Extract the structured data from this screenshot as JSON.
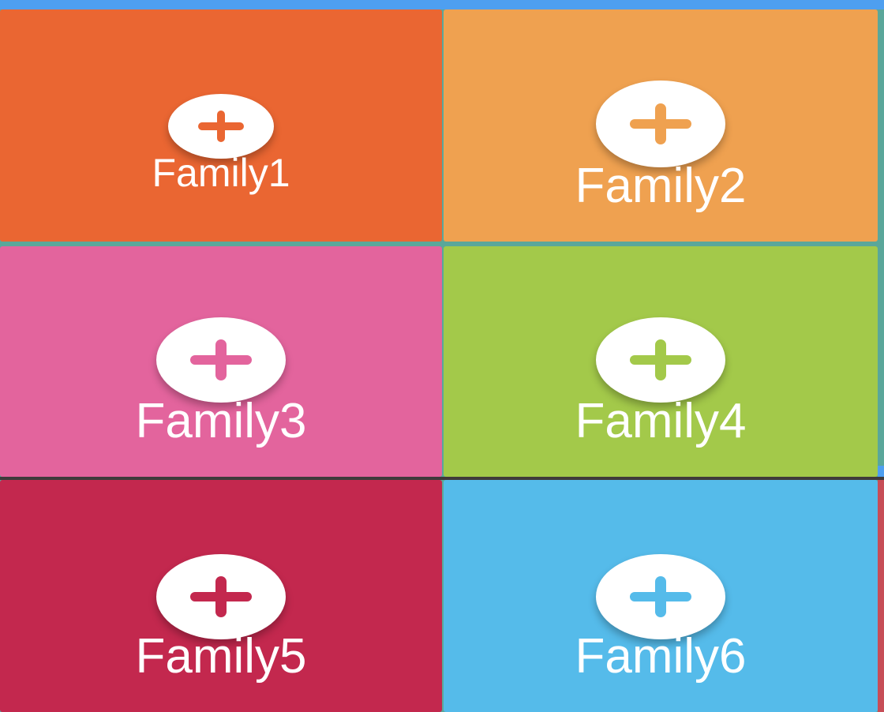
{
  "tiles": [
    {
      "label": "Family1",
      "color": "#ea6632",
      "icon": "add-icon"
    },
    {
      "label": "Family2",
      "color": "#efa150",
      "icon": "add-icon"
    },
    {
      "label": "Family3",
      "color": "#e3649d",
      "icon": "add-icon"
    },
    {
      "label": "Family4",
      "color": "#a3c94a",
      "icon": "add-icon"
    },
    {
      "label": "Family5",
      "color": "#c3284e",
      "icon": "add-icon"
    },
    {
      "label": "Family6",
      "color": "#55bbea",
      "icon": "add-icon"
    }
  ],
  "colors": {
    "top_strip": "#4e9ff0",
    "icon_background": "#ffffff",
    "label_text": "#ffffff"
  }
}
